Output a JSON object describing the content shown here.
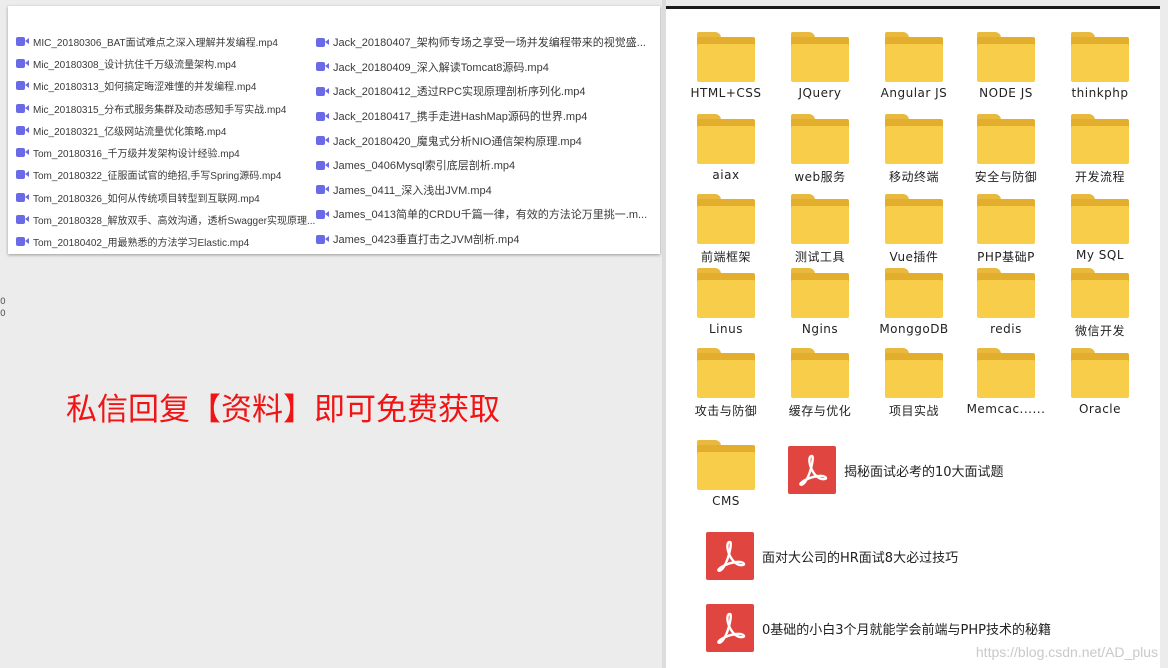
{
  "video_list": {
    "left_column": [
      "MIC_20180306_BAT面试难点之深入理解并发编程.mp4",
      "Mic_20180308_设计抗住千万级流量架构.mp4",
      "Mic_20180313_如何搞定晦涩难懂的并发编程.mp4",
      "Mic_20180315_分布式服务集群及动态感知手写实战.mp4",
      "Mic_20180321_亿级网站流量优化策略.mp4",
      "Tom_20180316_千万级并发架构设计经验.mp4",
      "Tom_20180322_征服面试官的绝招,手写Spring源码.mp4",
      "Tom_20180326_如何从传统项目转型到互联网.mp4",
      "Tom_20180328_解放双手、高效沟通，透析Swagger实现原理...",
      "Tom_20180402_用最熟悉的方法学习Elastic.mp4"
    ],
    "right_column": [
      "Jack_20180407_架构师专场之享受一场并发编程带来的视觉盛...",
      "Jack_20180409_深入解读Tomcat8源码.mp4",
      "Jack_20180412_透过RPC实现原理剖析序列化.mp4",
      "Jack_20180417_携手走进HashMap源码的世界.mp4",
      "Jack_20180420_魔鬼式分析NIO通信架构原理.mp4",
      "James_0406Mysql索引底层剖析.mp4",
      "James_0411_深入浅出JVM.mp4",
      "James_0413简单的CRDU千篇一律，有效的方法论万里挑一.m...",
      "James_0423垂直打击之JVM剖析.mp4"
    ]
  },
  "promo_text": "私信回复【资料】即可免费获取",
  "folders": [
    [
      "HTML+CSS",
      "JQuery",
      "Angular JS",
      "NODE JS",
      "thinkphp"
    ],
    [
      "aiax",
      "web服务",
      "移动终端",
      "安全与防御",
      "开发流程"
    ],
    [
      "前端框架",
      "测试工具",
      "Vue插件",
      "PHP基础P",
      "My SQL"
    ],
    [
      "Linus",
      "Ngins",
      "MonggoDB",
      "redis",
      "微信开发"
    ],
    [
      "攻击与防御",
      "缓存与优化",
      "项目实战",
      "Memcac......",
      "Oracle"
    ],
    [
      "CMS"
    ]
  ],
  "pdfs": [
    "揭秘面试必考的10大面试题",
    "面对大公司的HR面试8大必过技巧",
    "0基础的小白3个月就能学会前端与PHP技术的秘籍"
  ],
  "watermark": "https://blog.csdn.net/AD_plus",
  "colors": {
    "promo": "#f01414",
    "folder": "#f7cd49",
    "pdf": "#e0453f",
    "video_icon": "#6b6ae6"
  },
  "icons": {
    "video": "video-file-icon",
    "folder": "folder-icon",
    "pdf": "pdf-icon"
  }
}
